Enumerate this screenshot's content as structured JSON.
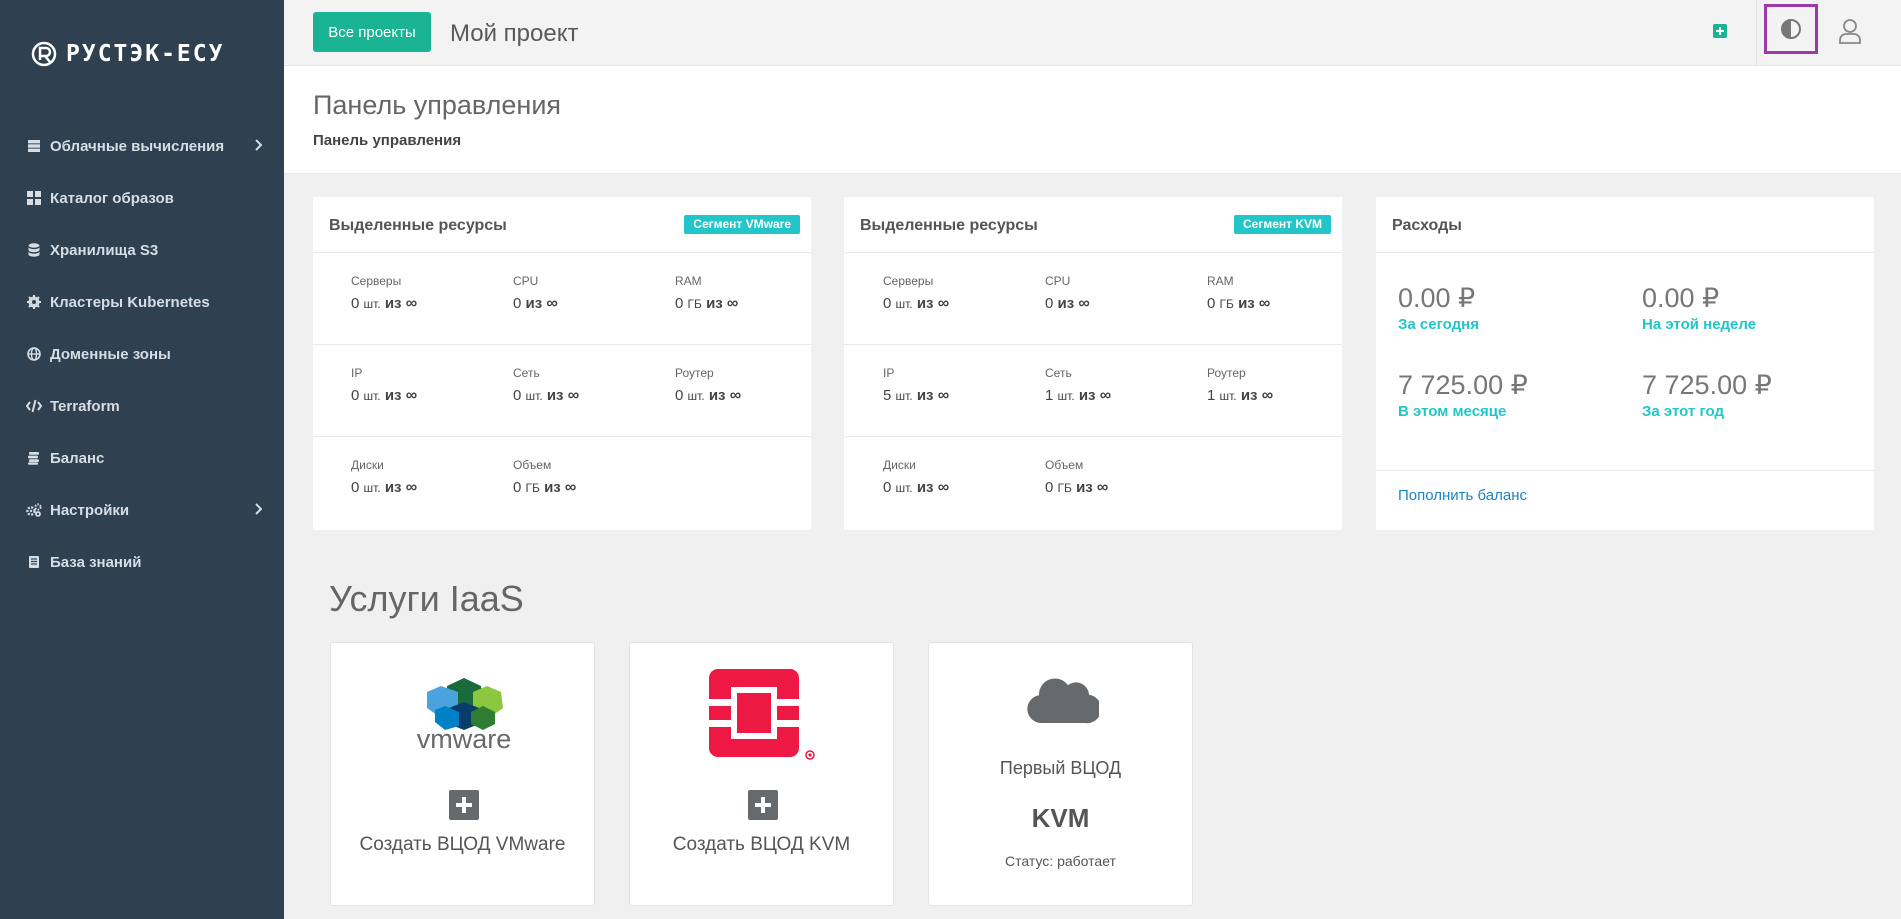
{
  "app": {
    "logo_text": "РУСТЭК-ЕСУ"
  },
  "sidebar": {
    "items": [
      {
        "label": "Облачные вычисления",
        "icon": "server-icon",
        "has_submenu": true
      },
      {
        "label": "Каталог образов",
        "icon": "grid-icon",
        "has_submenu": false
      },
      {
        "label": "Хранилища S3",
        "icon": "database-icon",
        "has_submenu": false
      },
      {
        "label": "Кластеры Kubernetes",
        "icon": "helm-icon",
        "has_submenu": false
      },
      {
        "label": "Доменные зоны",
        "icon": "globe-icon",
        "has_submenu": false
      },
      {
        "label": "Terraform",
        "icon": "code-icon",
        "has_submenu": false
      },
      {
        "label": "Баланс",
        "icon": "coins-icon",
        "has_submenu": false
      },
      {
        "label": "Настройки",
        "icon": "gears-icon",
        "has_submenu": true
      },
      {
        "label": "База знаний",
        "icon": "book-icon",
        "has_submenu": false
      }
    ]
  },
  "topbar": {
    "all_projects_label": "Все проекты",
    "project_title": "Мой проект"
  },
  "page": {
    "title": "Панель управления",
    "breadcrumb": "Панель управления"
  },
  "resources": [
    {
      "title": "Выделенные ресурсы",
      "segment": "Сегмент VMware",
      "rows": [
        [
          {
            "label": "Серверы",
            "value": "0",
            "unit": "шт.",
            "of": "из",
            "limit": "∞"
          },
          {
            "label": "CPU",
            "value": "0",
            "unit": "",
            "of": "из",
            "limit": "∞"
          },
          {
            "label": "RAM",
            "value": "0",
            "unit": "ГБ",
            "of": "из",
            "limit": "∞"
          }
        ],
        [
          {
            "label": "IP",
            "value": "0",
            "unit": "шт.",
            "of": "из",
            "limit": "∞"
          },
          {
            "label": "Сеть",
            "value": "0",
            "unit": "шт.",
            "of": "из",
            "limit": "∞"
          },
          {
            "label": "Роутер",
            "value": "0",
            "unit": "шт.",
            "of": "из",
            "limit": "∞"
          }
        ],
        [
          {
            "label": "Диски",
            "value": "0",
            "unit": "шт.",
            "of": "из",
            "limit": "∞"
          },
          {
            "label": "Объем",
            "value": "0",
            "unit": "ГБ",
            "of": "из",
            "limit": "∞"
          }
        ]
      ]
    },
    {
      "title": "Выделенные ресурсы",
      "segment": "Сегмент KVM",
      "rows": [
        [
          {
            "label": "Серверы",
            "value": "0",
            "unit": "шт.",
            "of": "из",
            "limit": "∞"
          },
          {
            "label": "CPU",
            "value": "0",
            "unit": "",
            "of": "из",
            "limit": "∞"
          },
          {
            "label": "RAM",
            "value": "0",
            "unit": "ГБ",
            "of": "из",
            "limit": "∞"
          }
        ],
        [
          {
            "label": "IP",
            "value": "5",
            "unit": "шт.",
            "of": "из",
            "limit": "∞"
          },
          {
            "label": "Сеть",
            "value": "1",
            "unit": "шт.",
            "of": "из",
            "limit": "∞"
          },
          {
            "label": "Роутер",
            "value": "1",
            "unit": "шт.",
            "of": "из",
            "limit": "∞"
          }
        ],
        [
          {
            "label": "Диски",
            "value": "0",
            "unit": "шт.",
            "of": "из",
            "limit": "∞"
          },
          {
            "label": "Объем",
            "value": "0",
            "unit": "ГБ",
            "of": "из",
            "limit": "∞"
          }
        ]
      ]
    }
  ],
  "expenses": {
    "title": "Расходы",
    "today": {
      "amount": "0.00 ₽",
      "label": "За сегодня"
    },
    "week": {
      "amount": "0.00 ₽",
      "label": "На этой неделе"
    },
    "month": {
      "amount": "7 725.00 ₽",
      "label": "В этом месяце"
    },
    "year": {
      "amount": "7 725.00 ₽",
      "label": "За этот год"
    },
    "topup_label": "Пополнить баланс"
  },
  "services": {
    "title": "Услуги IaaS",
    "vmware": {
      "logo_text": "vmware",
      "label": "Создать ВЦОД VMware"
    },
    "kvm": {
      "label": "Создать ВЦОД KVM"
    },
    "existing": {
      "name": "Первый ВЦОД",
      "type": "KVM",
      "status": "Статус: работает"
    }
  },
  "colors": {
    "sidebar_bg": "#2f4050",
    "accent": "#1ab394",
    "badge": "#23c6c8",
    "link": "#1c84c6",
    "highlight": "#9b3aa8",
    "openstack_red": "#ed1944"
  }
}
